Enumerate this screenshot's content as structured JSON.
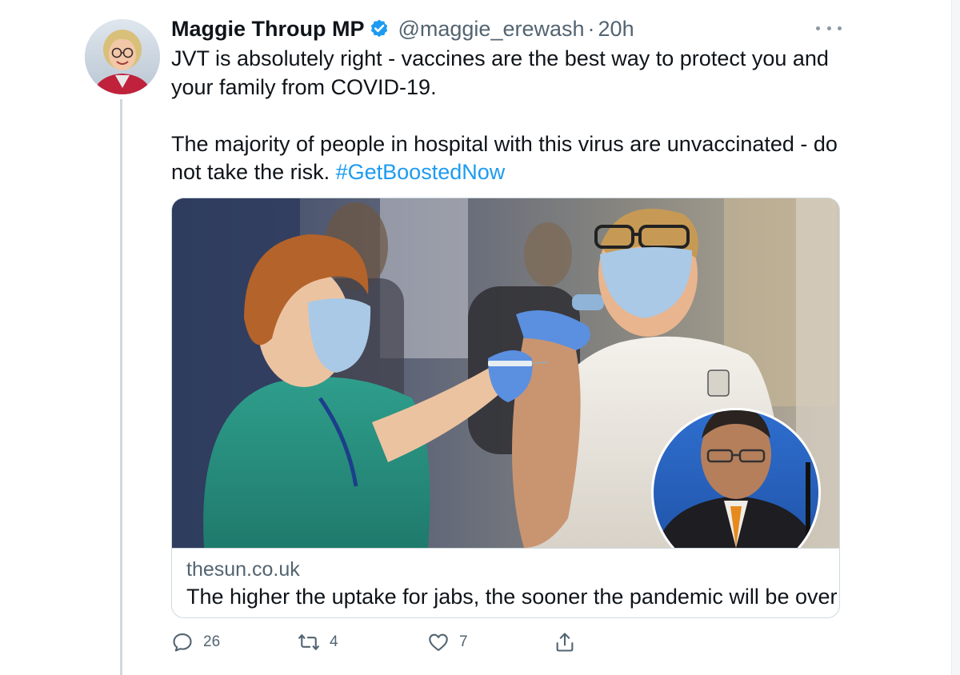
{
  "author": {
    "name": "Maggie Throup MP",
    "handle": "@maggie_erewash",
    "separator": "·",
    "time": "20h",
    "verified": true,
    "avatar_icon": "avatar-photo-icon"
  },
  "tweet": {
    "line1": "JVT is absolutely right - vaccines are the best way to protect you and your family from COVID-19.",
    "line2_text": "The majority of people in hospital with this virus are unvaccinated - do not take the risk.",
    "hashtag": "#GetBoostedNow"
  },
  "card": {
    "image_icon": "vaccination-photo-icon",
    "domain": "thesun.co.uk",
    "title": "The higher the uptake for jabs, the sooner the pandemic will be over"
  },
  "actions": {
    "reply_count": "26",
    "retweet_count": "4",
    "like_count": "7"
  },
  "colors": {
    "accent": "#1d9bf0",
    "secondary_text": "#536471",
    "border": "#cfd9de"
  }
}
